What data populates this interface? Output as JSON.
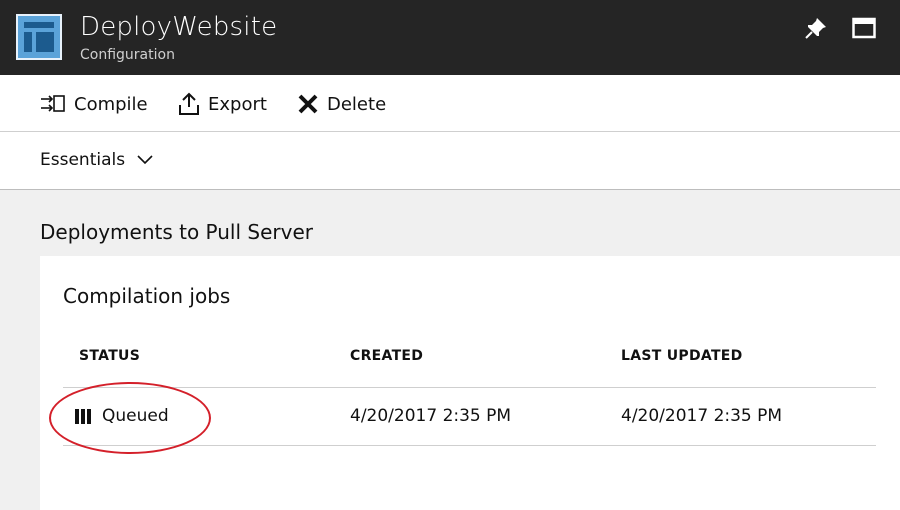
{
  "header": {
    "title": "DeployWebsite",
    "subtitle": "Configuration",
    "icons": {
      "app": "automation-config-icon",
      "pin": "pin-icon",
      "maximize": "maximize-icon"
    }
  },
  "toolbar": {
    "compile_label": "Compile",
    "export_label": "Export",
    "delete_label": "Delete"
  },
  "essentials": {
    "label": "Essentials"
  },
  "section": {
    "title": "Deployments to Pull Server"
  },
  "jobs": {
    "title": "Compilation jobs",
    "columns": [
      "STATUS",
      "CREATED",
      "LAST UPDATED"
    ],
    "rows": [
      {
        "status": "Queued",
        "created": "4/20/2017 2:35 PM",
        "last_updated": "4/20/2017 2:35 PM"
      }
    ]
  },
  "colors": {
    "header_bg": "#252525",
    "accent": "#5ba3d9",
    "highlight": "#d4202a"
  }
}
